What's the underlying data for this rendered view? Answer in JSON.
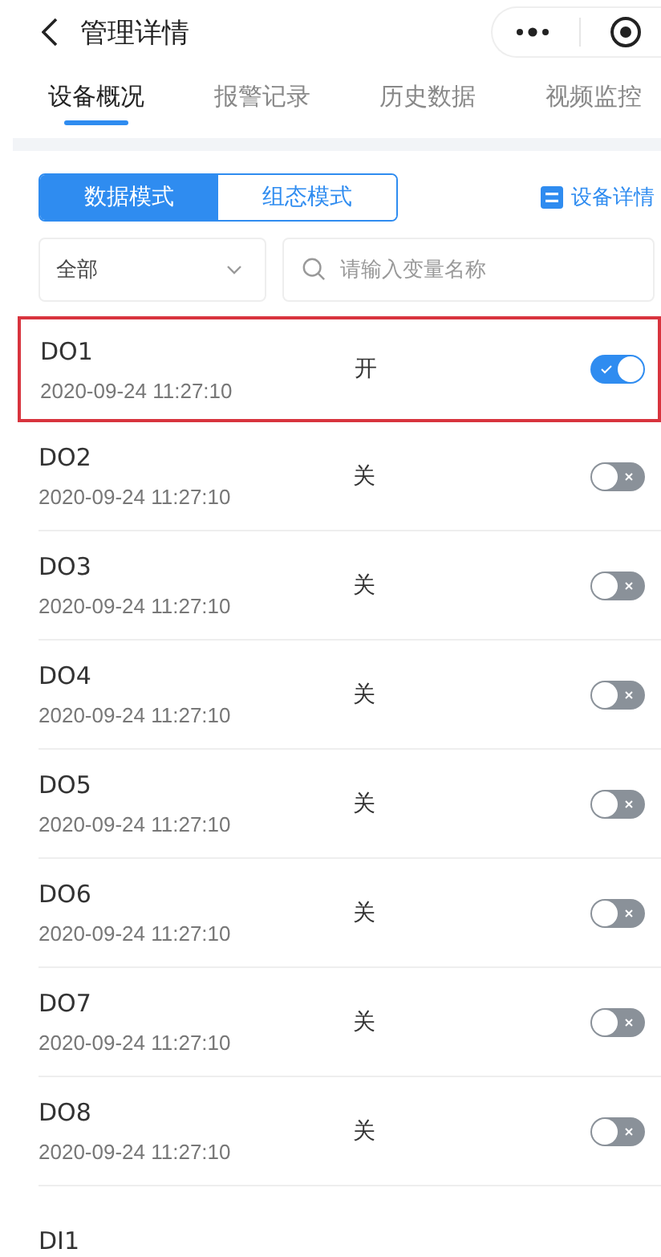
{
  "header": {
    "title": "管理详情"
  },
  "tabs": [
    {
      "label": "设备概况",
      "selected": true
    },
    {
      "label": "报警记录",
      "selected": false
    },
    {
      "label": "历史数据",
      "selected": false
    },
    {
      "label": "视频监控",
      "selected": false
    }
  ],
  "modes": [
    {
      "label": "数据模式",
      "selected": true
    },
    {
      "label": "组态模式",
      "selected": false
    }
  ],
  "detail_link": "设备详情",
  "filter": {
    "value": "全部",
    "search_placeholder": "请输入变量名称"
  },
  "variables": [
    {
      "name": "DO1",
      "time": "2020-09-24 11:27:10",
      "state": "开",
      "on": true,
      "selected": true
    },
    {
      "name": "DO2",
      "time": "2020-09-24 11:27:10",
      "state": "关",
      "on": false,
      "selected": false
    },
    {
      "name": "DO3",
      "time": "2020-09-24 11:27:10",
      "state": "关",
      "on": false,
      "selected": false
    },
    {
      "name": "DO4",
      "time": "2020-09-24 11:27:10",
      "state": "关",
      "on": false,
      "selected": false
    },
    {
      "name": "DO5",
      "time": "2020-09-24 11:27:10",
      "state": "关",
      "on": false,
      "selected": false
    },
    {
      "name": "DO6",
      "time": "2020-09-24 11:27:10",
      "state": "关",
      "on": false,
      "selected": false
    },
    {
      "name": "DO7",
      "time": "2020-09-24 11:27:10",
      "state": "关",
      "on": false,
      "selected": false
    },
    {
      "name": "DO8",
      "time": "2020-09-24 11:27:10",
      "state": "关",
      "on": false,
      "selected": false
    },
    {
      "name": "DI1",
      "selected": false
    }
  ]
}
